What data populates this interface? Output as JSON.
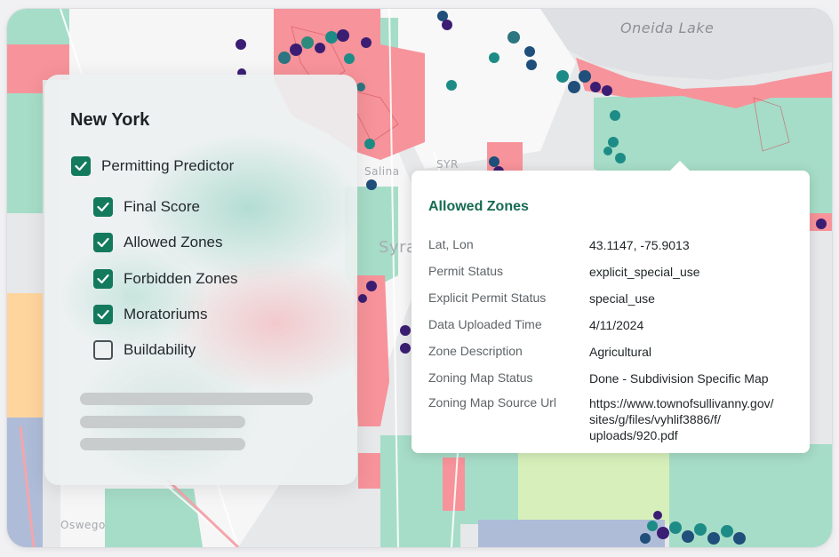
{
  "map": {
    "place_labels": [
      "Oneida Lake",
      "Salina",
      "SYR",
      "Syra",
      "Oswego"
    ],
    "colors": {
      "allowed": "#9fdcc4",
      "forbidden": "#f58e93",
      "moratorium_dot": "#3b1e73",
      "allowed_dot": "#1e8c86",
      "dot_blue": "#1f4f7a",
      "buildability_orange": "#ffd39a",
      "county_blue": "#a9b9d6",
      "county_lime": "#d6f0b7"
    }
  },
  "layers_panel": {
    "title": "New York",
    "parent_layer": {
      "label": "Permitting Predictor",
      "checked": true
    },
    "layers": [
      {
        "label": "Final Score",
        "checked": true
      },
      {
        "label": "Allowed Zones",
        "checked": true
      },
      {
        "label": "Forbidden Zones",
        "checked": true
      },
      {
        "label": "Moratoriums",
        "checked": true
      },
      {
        "label": "Buildability",
        "checked": false
      }
    ]
  },
  "info_card": {
    "title": "Allowed Zones",
    "rows": [
      {
        "label": "Lat, Lon",
        "value": "43.1147, -75.9013"
      },
      {
        "label": "Permit Status",
        "value": "explicit_special_use"
      },
      {
        "label": "Explicit Permit Status",
        "value": "special_use"
      },
      {
        "label": "Data Uploaded Time",
        "value": "4/11/2024"
      },
      {
        "label": "Zone Description",
        "value": "Agricultural"
      },
      {
        "label": "Zoning Map Status",
        "value": "Done - Subdivision Specific Map"
      },
      {
        "label": "Zoning Map Source Url",
        "value": "https://www.townofsullivanny.gov/ sites/g/files/vyhlif3886/f/ uploads/920.pdf"
      }
    ]
  }
}
